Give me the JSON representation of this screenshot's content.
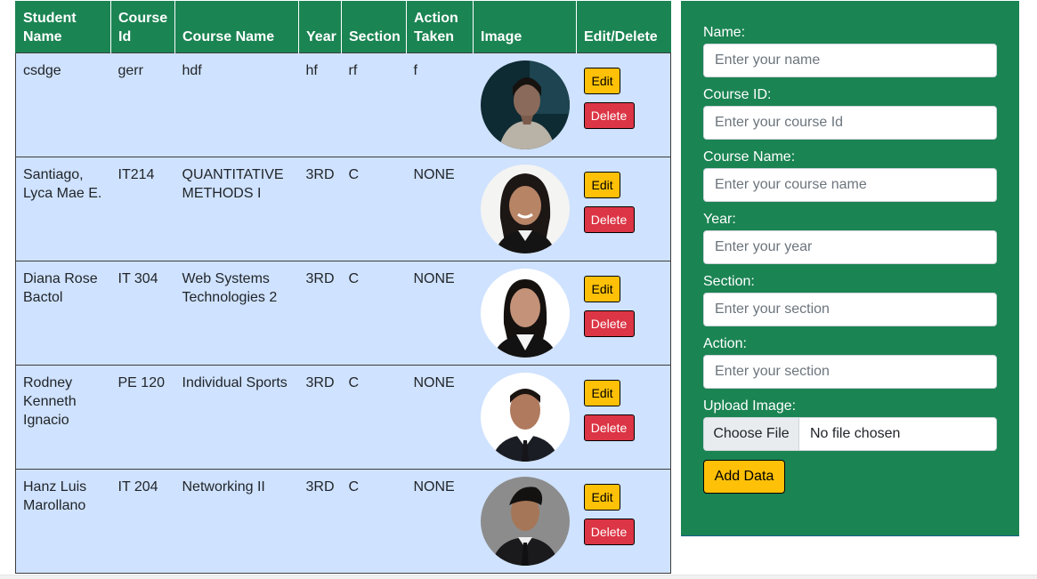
{
  "table": {
    "headers": [
      "Student Name",
      "Course Id",
      "Course Name",
      "Year",
      "Section",
      "Action Taken",
      "Image",
      "Edit/Delete"
    ],
    "rows": [
      {
        "name": "csdge",
        "course_id": "gerr",
        "course_name": "hdf",
        "year": "hf",
        "section": "rf",
        "action": "f"
      },
      {
        "name": "Santiago, Lyca Mae E.",
        "course_id": "IT214",
        "course_name": "QUANTITATIVE METHODS I",
        "year": "3RD",
        "section": "C",
        "action": "NONE"
      },
      {
        "name": "Diana Rose Bactol",
        "course_id": "IT 304",
        "course_name": "Web Systems Technologies 2",
        "year": "3RD",
        "section": "C",
        "action": "NONE"
      },
      {
        "name": "Rodney Kenneth Ignacio",
        "course_id": "PE 120",
        "course_name": "Individual Sports",
        "year": "3RD",
        "section": "C",
        "action": "NONE"
      },
      {
        "name": "Hanz Luis Marollano",
        "course_id": "IT 204",
        "course_name": "Networking II",
        "year": "3RD",
        "section": "C",
        "action": "NONE"
      }
    ],
    "edit_label": "Edit",
    "delete_label": "Delete"
  },
  "form": {
    "name_label": "Name:",
    "name_placeholder": "Enter your name",
    "course_id_label": "Course ID:",
    "course_id_placeholder": "Enter your course Id",
    "course_name_label": "Course Name:",
    "course_name_placeholder": "Enter your course name",
    "year_label": "Year:",
    "year_placeholder": "Enter your year",
    "section_label": "Section:",
    "section_placeholder": "Enter your section",
    "action_label": "Action:",
    "action_placeholder": "Enter your section",
    "upload_label": "Upload Image:",
    "choose_file_label": "Choose File",
    "file_status": "No file chosen",
    "submit_label": "Add Data"
  },
  "colors": {
    "header_green": "#1b8453",
    "row_blue": "#cfe2ff",
    "edit_yellow": "#ffc107",
    "delete_red": "#dc3545"
  }
}
